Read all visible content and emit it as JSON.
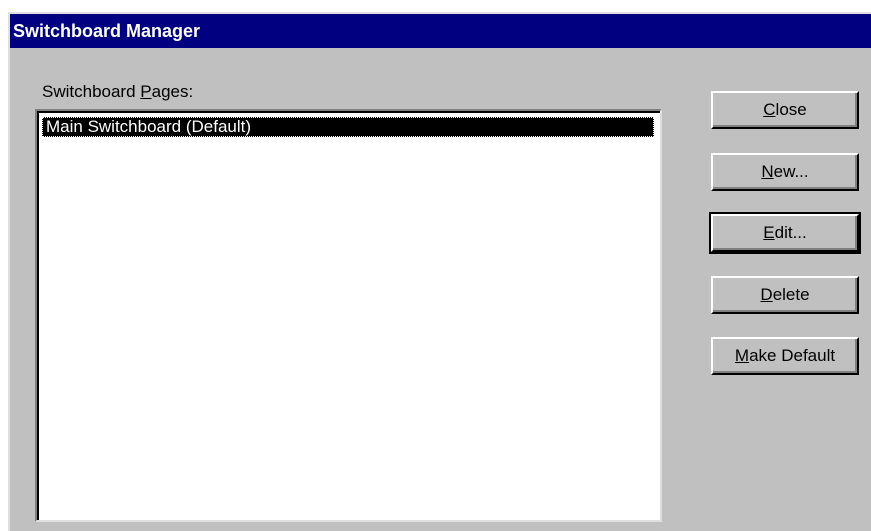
{
  "window": {
    "title": "Switchboard Manager"
  },
  "pages_label": {
    "before": "Switchboard ",
    "accel": "P",
    "after": "ages:"
  },
  "pages_list": [
    "Main Switchboard (Default)"
  ],
  "buttons": {
    "close": {
      "accel": "C",
      "rest": "lose"
    },
    "new": {
      "accel": "N",
      "rest": "ew..."
    },
    "edit": {
      "accel": "E",
      "rest": "dit..."
    },
    "delete": {
      "accel": "D",
      "rest": "elete"
    },
    "make_default": {
      "accel": "M",
      "rest": "ake Default"
    }
  },
  "colors": {
    "title_bar": "#000080",
    "dialog_face": "#c0c0c0",
    "selection": "#000000"
  }
}
